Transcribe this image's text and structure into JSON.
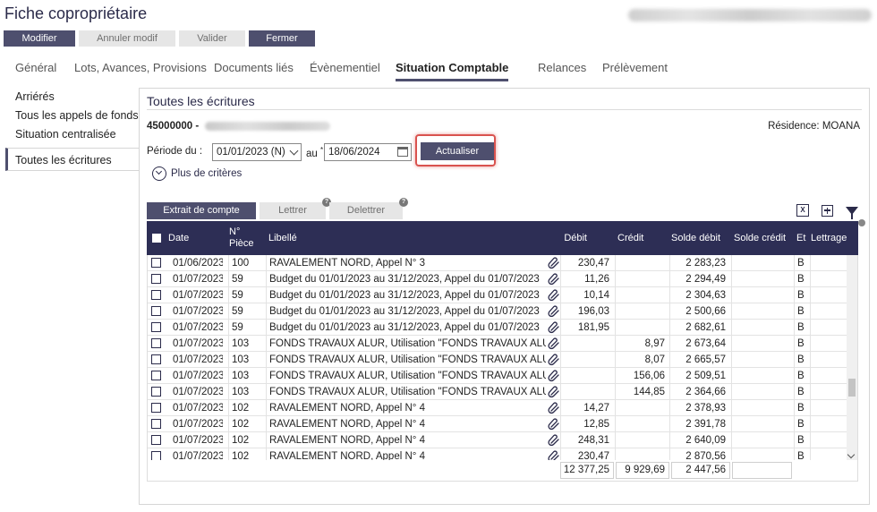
{
  "title": "Fiche copropriétaire",
  "toolbar": {
    "modifier": "Modifier",
    "annuler": "Annuler modif",
    "valider": "Valider",
    "fermer": "Fermer"
  },
  "tabs": [
    {
      "label": "Général"
    },
    {
      "label": "Lots, Avances, Provisions"
    },
    {
      "label": "Documents liés"
    },
    {
      "label": "Évènementiel"
    },
    {
      "label": "Situation Comptable"
    },
    {
      "label": "Relances"
    },
    {
      "label": "Prélèvement"
    }
  ],
  "sidenav": {
    "items": [
      {
        "label": "Arriérés"
      },
      {
        "label": "Tous les appels de fonds"
      },
      {
        "label": "Situation centralisée"
      },
      {
        "label": "Toutes les écritures"
      }
    ]
  },
  "panel": {
    "title": "Toutes les écritures",
    "account_number": "45000000 -",
    "residence": "Résidence: MOANA",
    "periode_label": "Période du :",
    "date_from": "01/01/2023 (N)",
    "au_label": "au",
    "required_mark": "*",
    "date_to": "18/06/2024",
    "actualiser": "Actualiser",
    "plus_criteres": "Plus de critères"
  },
  "actions": {
    "extrait": "Extrait de compte",
    "lettrer": "Lettrer",
    "delettrer": "Delettrer",
    "help_mark": "?",
    "excel_glyph": "X"
  },
  "table": {
    "headers": {
      "date": "Date",
      "no": "N°",
      "piece": "Pièce",
      "libelle": "Libellé",
      "debit": "Débit",
      "credit": "Crédit",
      "solde_debit": "Solde débit",
      "solde_credit": "Solde crédit",
      "etat": "Et",
      "lettrage": "Lettrage"
    },
    "rows": [
      {
        "date": "01/06/2023",
        "piece": "100",
        "libelle": "RAVALEMENT NORD, Appel N° 3",
        "debit": "230,47",
        "credit": "",
        "solde_debit": "2 283,23",
        "etat": "B"
      },
      {
        "date": "01/07/2023",
        "piece": "59",
        "libelle": "Budget du 01/01/2023 au 31/12/2023, Appel du 01/07/2023",
        "debit": "11,26",
        "credit": "",
        "solde_debit": "2 294,49",
        "etat": "B"
      },
      {
        "date": "01/07/2023",
        "piece": "59",
        "libelle": "Budget du 01/01/2023 au 31/12/2023, Appel du 01/07/2023",
        "debit": "10,14",
        "credit": "",
        "solde_debit": "2 304,63",
        "etat": "B"
      },
      {
        "date": "01/07/2023",
        "piece": "59",
        "libelle": "Budget du 01/01/2023 au 31/12/2023, Appel du 01/07/2023",
        "debit": "196,03",
        "credit": "",
        "solde_debit": "2 500,66",
        "etat": "B"
      },
      {
        "date": "01/07/2023",
        "piece": "59",
        "libelle": "Budget du 01/01/2023 au 31/12/2023, Appel du 01/07/2023",
        "debit": "181,95",
        "credit": "",
        "solde_debit": "2 682,61",
        "etat": "B"
      },
      {
        "date": "01/07/2023",
        "piece": "103",
        "libelle": "FONDS TRAVAUX ALUR, Utilisation \"FONDS TRAVAUX ALUR\" pour Ra",
        "debit": "",
        "credit": "8,97",
        "solde_debit": "2 673,64",
        "etat": "B"
      },
      {
        "date": "01/07/2023",
        "piece": "103",
        "libelle": "FONDS TRAVAUX ALUR, Utilisation \"FONDS TRAVAUX ALUR\" pour Ra",
        "debit": "",
        "credit": "8,07",
        "solde_debit": "2 665,57",
        "etat": "B"
      },
      {
        "date": "01/07/2023",
        "piece": "103",
        "libelle": "FONDS TRAVAUX ALUR, Utilisation \"FONDS TRAVAUX ALUR\" pour Ra",
        "debit": "",
        "credit": "156,06",
        "solde_debit": "2 509,51",
        "etat": "B"
      },
      {
        "date": "01/07/2023",
        "piece": "103",
        "libelle": "FONDS TRAVAUX ALUR, Utilisation \"FONDS TRAVAUX ALUR\" pour Ra",
        "debit": "",
        "credit": "144,85",
        "solde_debit": "2 364,66",
        "etat": "B"
      },
      {
        "date": "01/07/2023",
        "piece": "102",
        "libelle": "RAVALEMENT NORD, Appel N° 4",
        "debit": "14,27",
        "credit": "",
        "solde_debit": "2 378,93",
        "etat": "B"
      },
      {
        "date": "01/07/2023",
        "piece": "102",
        "libelle": "RAVALEMENT NORD, Appel N° 4",
        "debit": "12,85",
        "credit": "",
        "solde_debit": "2 391,78",
        "etat": "B"
      },
      {
        "date": "01/07/2023",
        "piece": "102",
        "libelle": "RAVALEMENT NORD, Appel N° 4",
        "debit": "248,31",
        "credit": "",
        "solde_debit": "2 640,09",
        "etat": "B"
      },
      {
        "date": "01/07/2023",
        "piece": "102",
        "libelle": "RAVALEMENT NORD, Appel N° 4",
        "debit": "230,47",
        "credit": "",
        "solde_debit": "2 870,56",
        "etat": "B"
      }
    ],
    "totals": {
      "debit": "12 377,25",
      "credit": "9 929,69",
      "solde_debit": "2 447,56",
      "solde_credit": ""
    }
  }
}
